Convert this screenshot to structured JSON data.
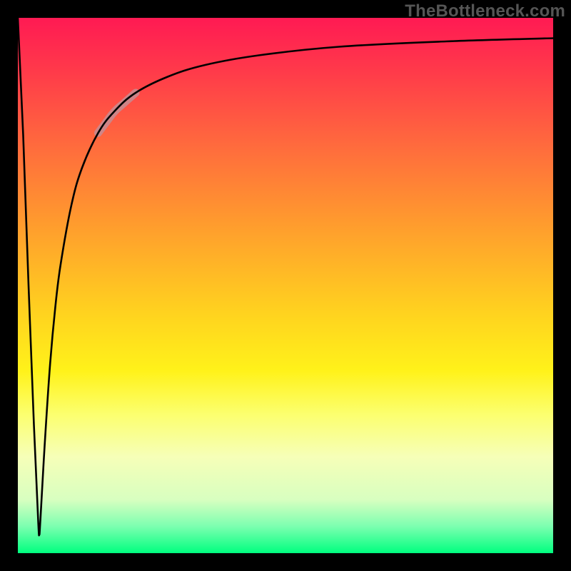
{
  "watermark": "TheBottleneck.com",
  "chart_data": {
    "type": "line",
    "title": "",
    "xlabel": "",
    "ylabel": "",
    "xlim": [
      0,
      100
    ],
    "ylim": [
      0,
      100
    ],
    "grid": false,
    "legend": false,
    "annotations": [],
    "gradient_background": {
      "orientation": "vertical",
      "stops": [
        {
          "pos": 0.0,
          "color": "#ff1a53"
        },
        {
          "pos": 0.1,
          "color": "#ff3a4a"
        },
        {
          "pos": 0.24,
          "color": "#ff6b3d"
        },
        {
          "pos": 0.38,
          "color": "#ff9a2e"
        },
        {
          "pos": 0.55,
          "color": "#ffd21f"
        },
        {
          "pos": 0.66,
          "color": "#fff21a"
        },
        {
          "pos": 0.74,
          "color": "#fcff6e"
        },
        {
          "pos": 0.82,
          "color": "#f6ffb8"
        },
        {
          "pos": 0.9,
          "color": "#d8ffc0"
        },
        {
          "pos": 0.95,
          "color": "#7cffb0"
        },
        {
          "pos": 1.0,
          "color": "#00ff7f"
        }
      ]
    },
    "series": [
      {
        "name": "bottleneck-curve",
        "color": "#000000",
        "stroke_width": 2.6,
        "x": [
          0.0,
          1.0,
          2.0,
          3.0,
          3.8,
          4.0,
          4.2,
          5.0,
          6.0,
          7.0,
          8.0,
          10.0,
          12.0,
          15.0,
          18.0,
          22.0,
          28.0,
          35.0,
          45.0,
          60.0,
          80.0,
          100.0
        ],
        "y": [
          100.0,
          78.0,
          50.0,
          24.0,
          6.0,
          3.5,
          6.0,
          20.0,
          35.0,
          46.0,
          54.0,
          65.0,
          72.0,
          78.5,
          82.5,
          86.0,
          89.0,
          91.2,
          93.0,
          94.6,
          95.6,
          96.2
        ]
      }
    ],
    "highlight_segment": {
      "series": "bottleneck-curve",
      "x_range": [
        15.0,
        22.0
      ],
      "color": "#c98a8f",
      "stroke_width": 11
    }
  }
}
